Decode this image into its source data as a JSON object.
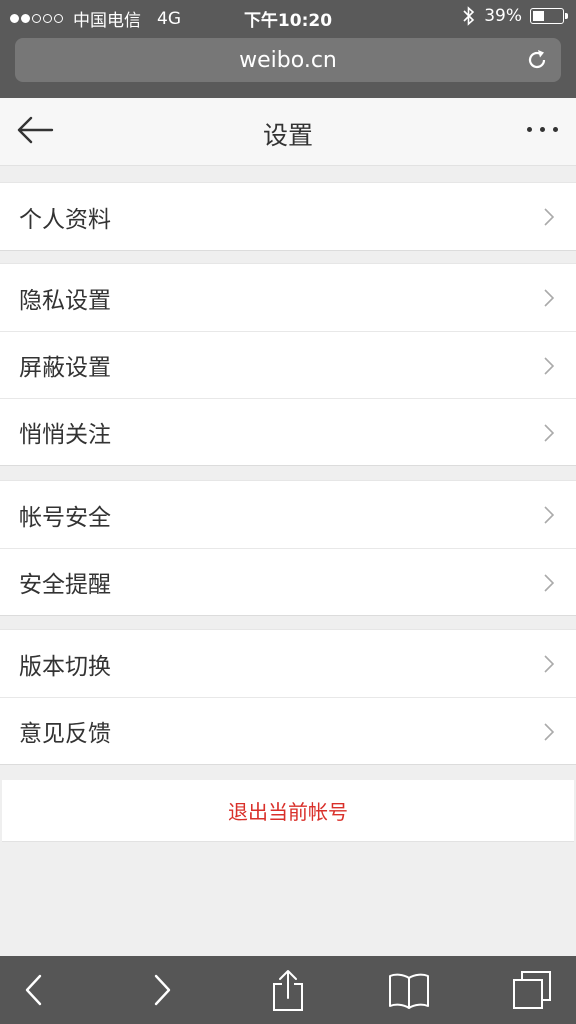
{
  "status_bar": {
    "carrier": "中国电信",
    "network": "4G",
    "time": "下午10:20",
    "battery": "39%",
    "battery_level": 0.39,
    "signal_strength": 2,
    "signal_total": 5
  },
  "browser": {
    "url": "weibo.cn",
    "chrome_color": "#5a5a5a"
  },
  "header": {
    "title": "设置",
    "back_icon": "back-arrow-icon",
    "more_icon": "more-dots-icon"
  },
  "groups": [
    {
      "items": [
        {
          "label": "个人资料"
        }
      ]
    },
    {
      "items": [
        {
          "label": "隐私设置"
        },
        {
          "label": "屏蔽设置"
        },
        {
          "label": "悄悄关注"
        }
      ]
    },
    {
      "items": [
        {
          "label": "帐号安全"
        },
        {
          "label": "安全提醒"
        }
      ]
    },
    {
      "items": [
        {
          "label": "版本切换"
        },
        {
          "label": "意见反馈"
        }
      ]
    }
  ],
  "logout": {
    "label": "退出当前帐号",
    "color": "#d9302a"
  },
  "toolbar": {
    "icons": [
      "back-icon",
      "forward-icon",
      "share-icon",
      "bookmarks-icon",
      "tabs-icon"
    ]
  }
}
